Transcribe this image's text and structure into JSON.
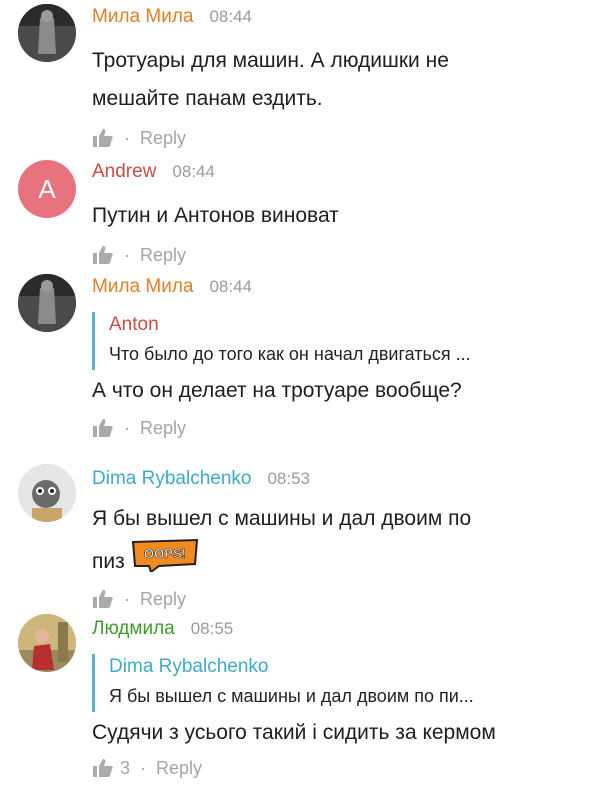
{
  "colors": {
    "orange": "#e07f27",
    "red": "#c94c45",
    "blue": "#3fa9c9",
    "green": "#3f9d2d",
    "quote_bar": "#5fb0d2",
    "avatar_andrew": "#e8737e"
  },
  "comments": [
    {
      "author": "Мила Мила",
      "time": "08:44",
      "text_lines": [
        "Тротуары для машин. А людишки не",
        "мешайте панам ездить."
      ],
      "reply_label": "Reply",
      "avatar_icon": "photo-avatar"
    },
    {
      "author": "Andrew",
      "avatar_letter": "A",
      "time": "08:44",
      "text_lines": [
        "Путин и Антонов виноват"
      ],
      "reply_label": "Reply"
    },
    {
      "author": "Мила Мила",
      "time": "08:44",
      "quote_author": "Anton",
      "quote_text": "Что было до того как он начал двигаться ...",
      "text_lines": [
        "А что он делает на тротуаре вообще?"
      ],
      "reply_label": "Reply"
    },
    {
      "author": "Dima Rybalchenko",
      "time": "08:53",
      "text_lines": [
        "Я бы вышел с машины и дал двоим по",
        "пиз"
      ],
      "sticker_text": "OOPS!",
      "reply_label": "Reply"
    },
    {
      "author": "Людмила",
      "time": "08:55",
      "quote_author": "Dima Rybalchenko",
      "quote_text": "Я бы вышел с машины и дал двоим по пи...",
      "text_lines": [
        "Судячи з усього такий і сидить за кермом"
      ],
      "likes": "3",
      "reply_label": "Reply"
    }
  ]
}
